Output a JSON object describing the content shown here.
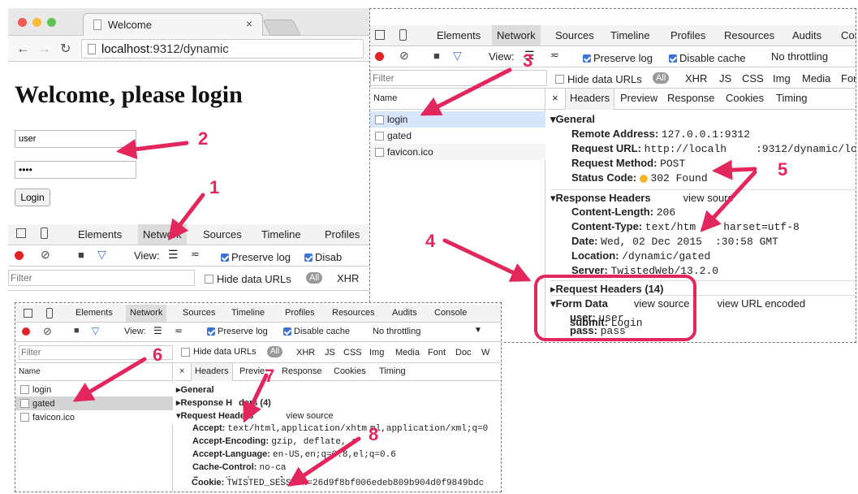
{
  "browser": {
    "tab_title": "Welcome",
    "url_host": "localhost",
    "url_rest": ":9312/dynamic"
  },
  "page": {
    "heading": "Welcome, please login",
    "user_value": "user",
    "pass_value": "••••",
    "login_button": "Login"
  },
  "devtools_tabs": [
    "Elements",
    "Network",
    "Sources",
    "Timeline",
    "Profiles",
    "Resources",
    "Audits",
    "Console"
  ],
  "devtools_tab_cor": "Cor",
  "toolbar": {
    "view": "View:",
    "preserve_log": "Preserve log",
    "disable_cache": "Disable cache",
    "disab_cut": "Disab",
    "throttling": "No throttling"
  },
  "filterbar": {
    "placeholder": "Filter",
    "hide_data_urls": "Hide data URLs",
    "all": "All",
    "types": [
      "XHR",
      "JS",
      "CSS",
      "Img",
      "Media",
      "Font",
      "Doc",
      "W"
    ],
    "types_cut": [
      "XHR",
      "JS",
      "CSS",
      "Img",
      "Media",
      "For"
    ]
  },
  "files": {
    "header": "Name",
    "items": [
      "login",
      "gated",
      "favicon.ico"
    ]
  },
  "detail_tabs": [
    "×",
    "Headers",
    "Preview",
    "Response",
    "Cookies",
    "Timing"
  ],
  "detail_tabs_bottom": [
    "×",
    "Headers",
    "Previe",
    "Response",
    "Cookies",
    "Timing"
  ],
  "top_detail": {
    "general": "General",
    "remote_k": "Remote Address:",
    "remote_v": "127.0.0.1:9312",
    "requrl_k": "Request URL:",
    "requrl_v": "http://localh",
    "requrl_v2": ":9312/dynamic/login",
    "method_k": "Request Method:",
    "method_v": "POST",
    "status_k": "Status Code:",
    "status_v": "302 Found",
    "resp_headers": "Response Headers",
    "view_source": "view source",
    "view_source_cut": "view sourc",
    "cl_k": "Content-Length:",
    "cl_v": "206",
    "ct_k": "Content-Type:",
    "ct_v": "text/htm",
    "ct_v2": "harset=utf-8",
    "date_k": "Date:",
    "date_v": "Wed, 02 Dec 2015",
    "date_v2": ":30:58 GMT",
    "loc_k": "Location:",
    "loc_v": "/dynamic/gated",
    "server_k": "Server:",
    "server_v": "TwistedWeb/13.2.0",
    "req_headers": "Request Headers (14)",
    "form_data": "Form Data",
    "view_url_encoded": "view URL encoded",
    "user_k": "user:",
    "user_v": "user",
    "pass_k": "pass:",
    "pass_v": "pass",
    "submit_k": "submit:",
    "submit_v": "Login"
  },
  "bottom_detail": {
    "general": "General",
    "resp_headers": "Response H",
    "resp_headers2": "ders (4)",
    "req_headers": "Request Headers",
    "view_source": "view source",
    "accept_k": "Accept:",
    "accept_v": "text/html,application/xhtm",
    "accept_v2": "ml,application/xml;q=0",
    "enc_k": "Accept-Encoding:",
    "enc_v": "gzip, deflate, s",
    "lang_k": "Accept-Language:",
    "lang_v": "en-US,en;q=0.8,el;q=0.6",
    "cache_k": "Cache-Control:",
    "cache_v": "no-ca",
    "conn_k": "Connection:",
    "conn_v": "keep-al",
    "cookie_k": "Cookie:",
    "cookie_v": "TWISTED_SESSION=26d9f8bf006edeb809b904d0f9849bdc"
  },
  "callouts": [
    "1",
    "2",
    "3",
    "4",
    "5",
    "6",
    "7",
    "8"
  ],
  "colors": {
    "accent": "#e3265c",
    "selected_row": "#d6e6fb",
    "checkbox": "#3b73d9",
    "record": "#e1242a"
  }
}
